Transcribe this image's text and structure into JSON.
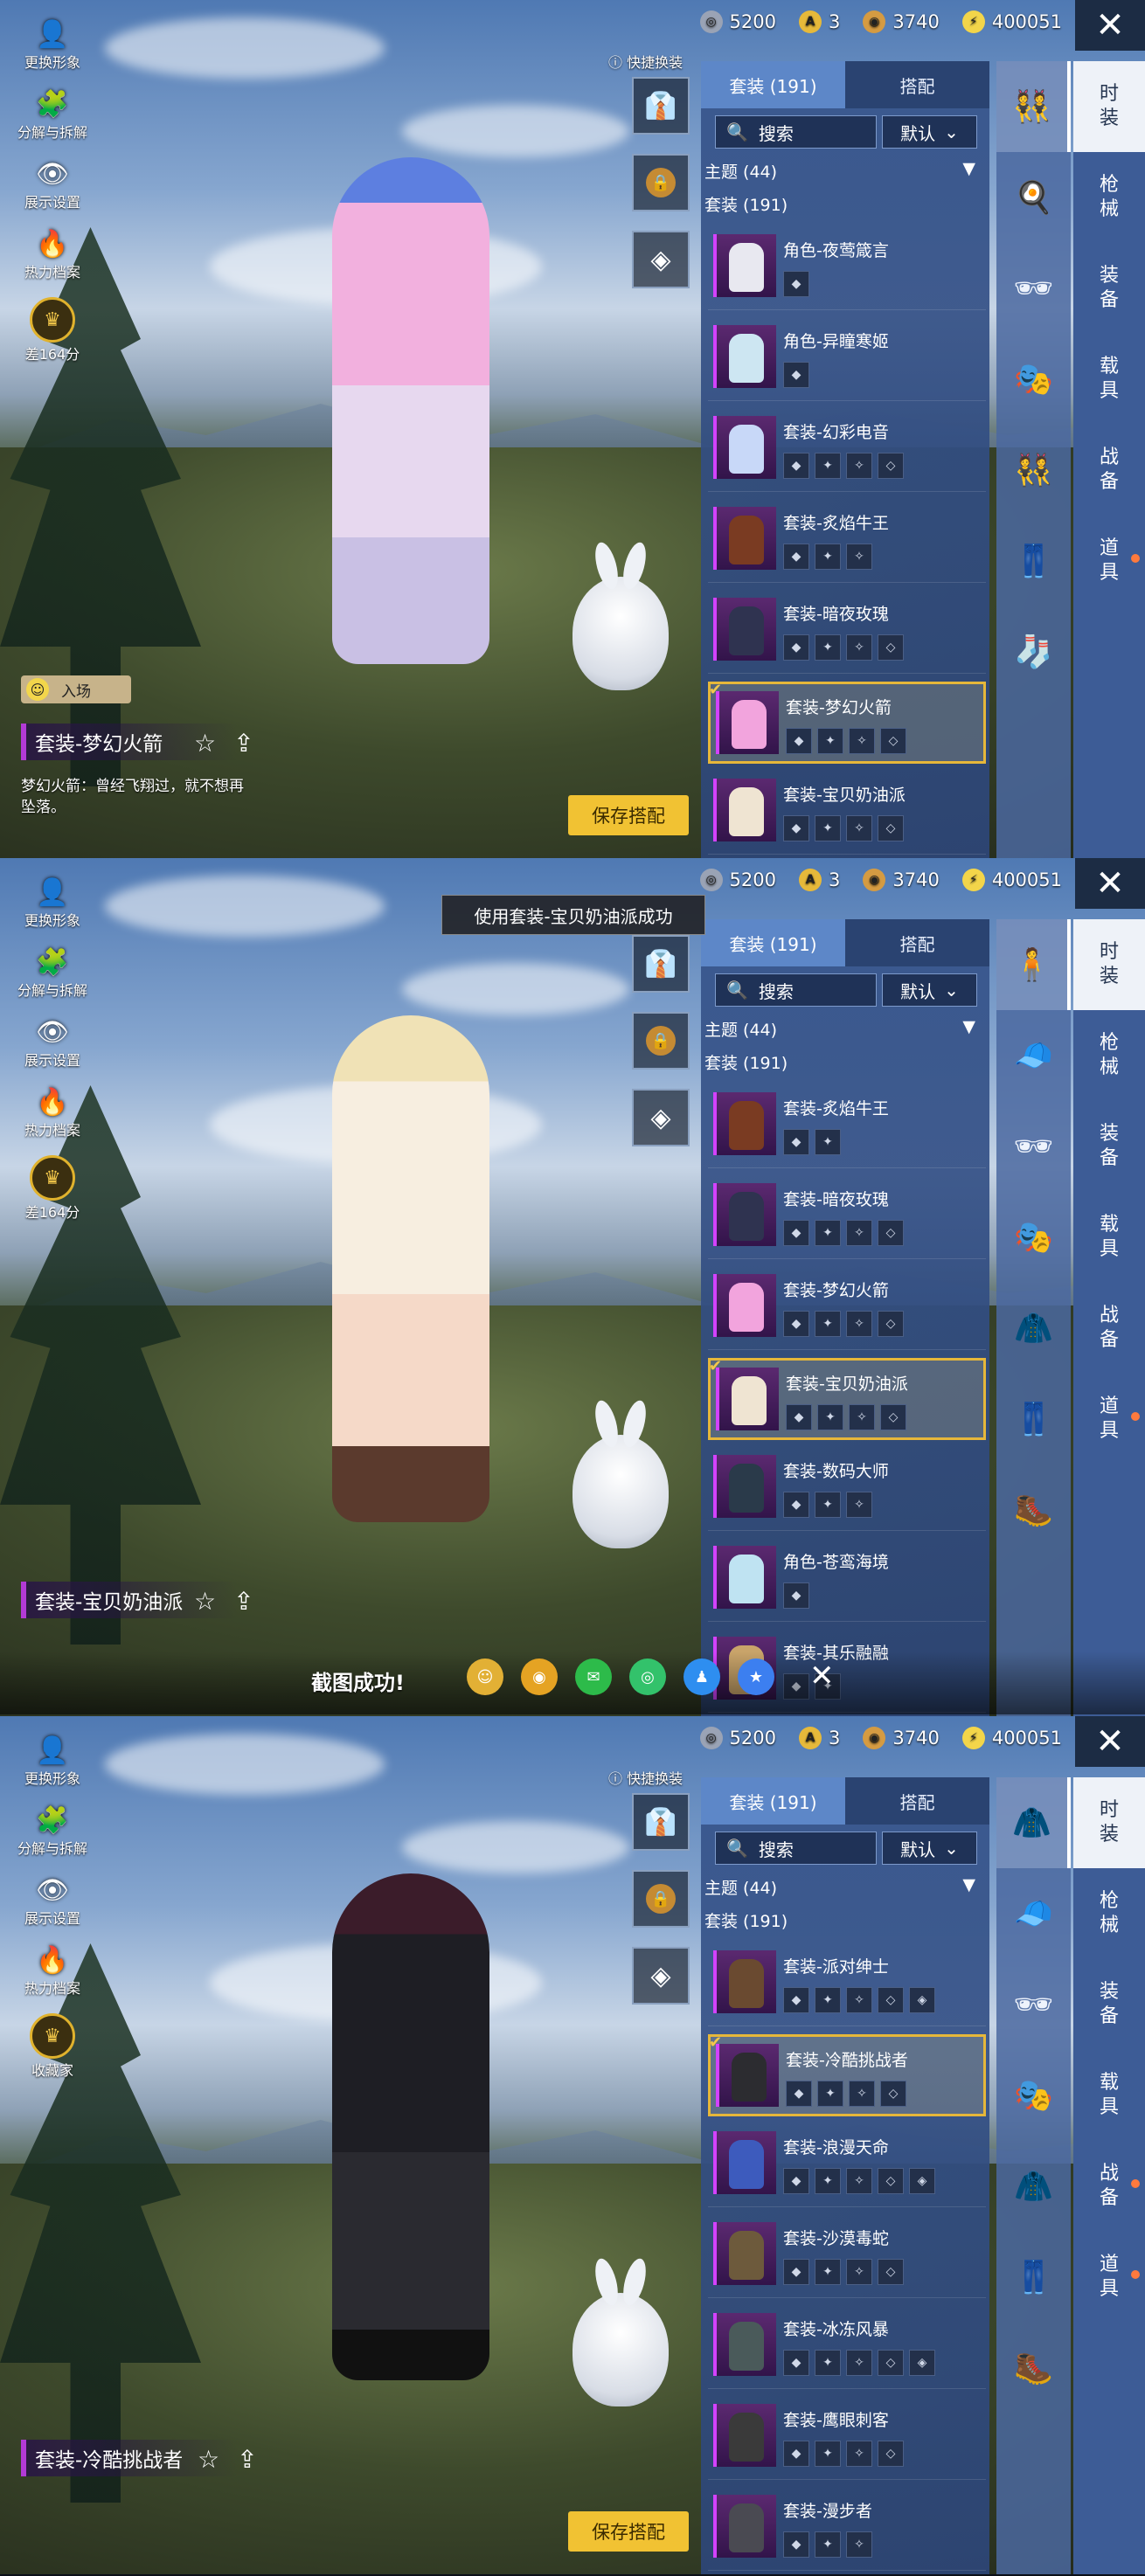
{
  "currency": {
    "silver": "5200",
    "tokens": "3",
    "gold": "3740",
    "points": "400051",
    "close": "✕"
  },
  "left_menu": {
    "change_look": "更换形象",
    "decompose": "分解与拆解",
    "display": "展示设置",
    "heat": "热力档案",
    "rank_p1": "差164分",
    "rank_p3": "收藏家"
  },
  "quick_swap": "快捷换装",
  "tabs": {
    "suits": "套装 (191)",
    "match": "搭配"
  },
  "search": {
    "placeholder": "搜索",
    "sort": "默认"
  },
  "topic": "主题 (44)",
  "suit_count": "套装 (191)",
  "right_nav": [
    "时装",
    "枪械",
    "装备",
    "载具",
    "战备",
    "道具"
  ],
  "save_label": "保存搭配",
  "panels": [
    {
      "entry_label": "入场",
      "current_suit": "套装-梦幻火箭",
      "description": "梦幻火箭：曾经飞翔过，就不想再坠落。",
      "items": [
        {
          "name": "角色-夜莺箴言",
          "parts": [
            "◆"
          ],
          "selected": false,
          "color": "#e8e8f0"
        },
        {
          "name": "角色-异瞳寒姬",
          "parts": [
            "◆"
          ],
          "selected": false,
          "color": "#cde6f2"
        },
        {
          "name": "套装-幻彩电音",
          "parts": [
            "◆",
            "✦",
            "✧",
            "◇"
          ],
          "selected": false,
          "color": "#c8d8f8"
        },
        {
          "name": "套装-炙焰牛王",
          "parts": [
            "◆",
            "✦",
            "✧"
          ],
          "selected": false,
          "color": "#7a3b22"
        },
        {
          "name": "套装-暗夜玫瑰",
          "parts": [
            "◆",
            "✦",
            "✧",
            "◇"
          ],
          "selected": false,
          "color": "#2f3350"
        },
        {
          "name": "套装-梦幻火箭",
          "parts": [
            "◆",
            "✦",
            "✧",
            "◇"
          ],
          "selected": true,
          "color": "#f2a4dd"
        },
        {
          "name": "套装-宝贝奶油派",
          "parts": [
            "◆",
            "✦",
            "✧",
            "◇"
          ],
          "selected": false,
          "color": "#efe4d2"
        }
      ]
    },
    {
      "current_suit": "套装-宝贝奶油派",
      "toast": "使用套装-宝贝奶油派成功",
      "share_text": "截图成功!",
      "items": [
        {
          "name": "套装-炙焰牛王",
          "parts": [
            "◆",
            "✦"
          ],
          "selected": false,
          "color": "#7a3b22"
        },
        {
          "name": "套装-暗夜玫瑰",
          "parts": [
            "◆",
            "✦",
            "✧",
            "◇"
          ],
          "selected": false,
          "color": "#2f3350"
        },
        {
          "name": "套装-梦幻火箭",
          "parts": [
            "◆",
            "✦",
            "✧",
            "◇"
          ],
          "selected": false,
          "color": "#f2a4dd"
        },
        {
          "name": "套装-宝贝奶油派",
          "parts": [
            "◆",
            "✦",
            "✧",
            "◇"
          ],
          "selected": true,
          "color": "#efe4d2"
        },
        {
          "name": "套装-数码大师",
          "parts": [
            "◆",
            "✦",
            "✧"
          ],
          "selected": false,
          "color": "#2a3a4a"
        },
        {
          "name": "角色-苍鸾海境",
          "parts": [
            "◆"
          ],
          "selected": false,
          "color": "#bfe3f2"
        },
        {
          "name": "套装-其乐融融",
          "parts": [
            "◆",
            "✦"
          ],
          "selected": false,
          "color": "#c9a46a"
        }
      ]
    },
    {
      "current_suit": "套装-冷酷挑战者",
      "items": [
        {
          "name": "套装-派对绅士",
          "parts": [
            "◆",
            "✦",
            "✧",
            "◇",
            "◈"
          ],
          "selected": false,
          "color": "#6a4a30"
        },
        {
          "name": "套装-冷酷挑战者",
          "parts": [
            "◆",
            "✦",
            "✧",
            "◇"
          ],
          "selected": true,
          "color": "#2c2c30"
        },
        {
          "name": "套装-浪漫天命",
          "parts": [
            "◆",
            "✦",
            "✧",
            "◇",
            "◈"
          ],
          "selected": false,
          "color": "#3d5bbd"
        },
        {
          "name": "套装-沙漠毒蛇",
          "parts": [
            "◆",
            "✦",
            "✧",
            "◇"
          ],
          "selected": false,
          "color": "#6d5a3c"
        },
        {
          "name": "套装-冰冻风暴",
          "parts": [
            "◆",
            "✦",
            "✧",
            "◇",
            "◈"
          ],
          "selected": false,
          "color": "#4a5a5a"
        },
        {
          "name": "套装-鹰眼刺客",
          "parts": [
            "◆",
            "✦",
            "✧",
            "◇"
          ],
          "selected": false,
          "color": "#3a3a3a"
        },
        {
          "name": "套装-漫步者",
          "parts": [
            "◆",
            "✦",
            "✧"
          ],
          "selected": false,
          "color": "#4a4a52"
        }
      ]
    }
  ]
}
